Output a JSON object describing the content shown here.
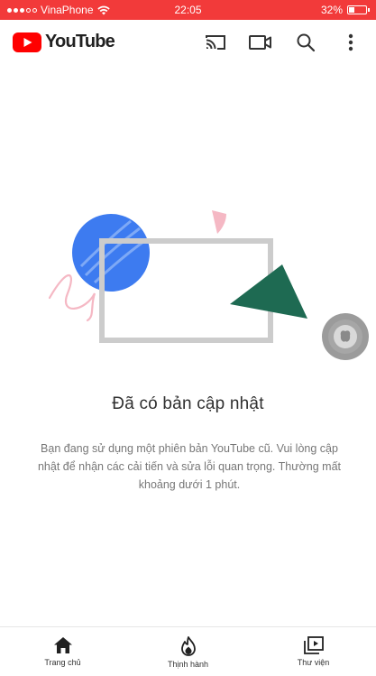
{
  "status_bar": {
    "carrier": "VinaPhone",
    "time": "22:05",
    "battery_percent": "32%",
    "battery_level": 0.32,
    "signal_icon": "signal-dots-icon",
    "wifi_icon": "wifi-icon"
  },
  "app_bar": {
    "logo_text": "YouTube",
    "logo_icon": "youtube-play-icon",
    "icons": [
      "cast-icon",
      "camera-icon",
      "search-icon",
      "more-vert-icon"
    ]
  },
  "message": {
    "title": "Đã có bản cập nhật",
    "body": "Bạn đang sử dụng một phiên bản YouTube cũ. Vui lòng cập nhật để nhận các cải tiến và sửa lỗi quan trọng. Thường mất khoảng dưới 1 phút."
  },
  "bottom_nav": {
    "items": [
      {
        "label": "Trang chủ",
        "icon": "home-icon",
        "active": true
      },
      {
        "label": "Thịnh hành",
        "icon": "trending-icon",
        "active": false
      },
      {
        "label": "Thư viện",
        "icon": "library-icon",
        "active": false
      }
    ]
  },
  "colors": {
    "status_bar": "#f23a3a",
    "youtube_red": "#ff0000",
    "illus_blue": "#3d7bf0",
    "illus_green": "#1e6a52",
    "illus_pink": "#f5b8c4",
    "illus_frame": "#cccccc"
  }
}
